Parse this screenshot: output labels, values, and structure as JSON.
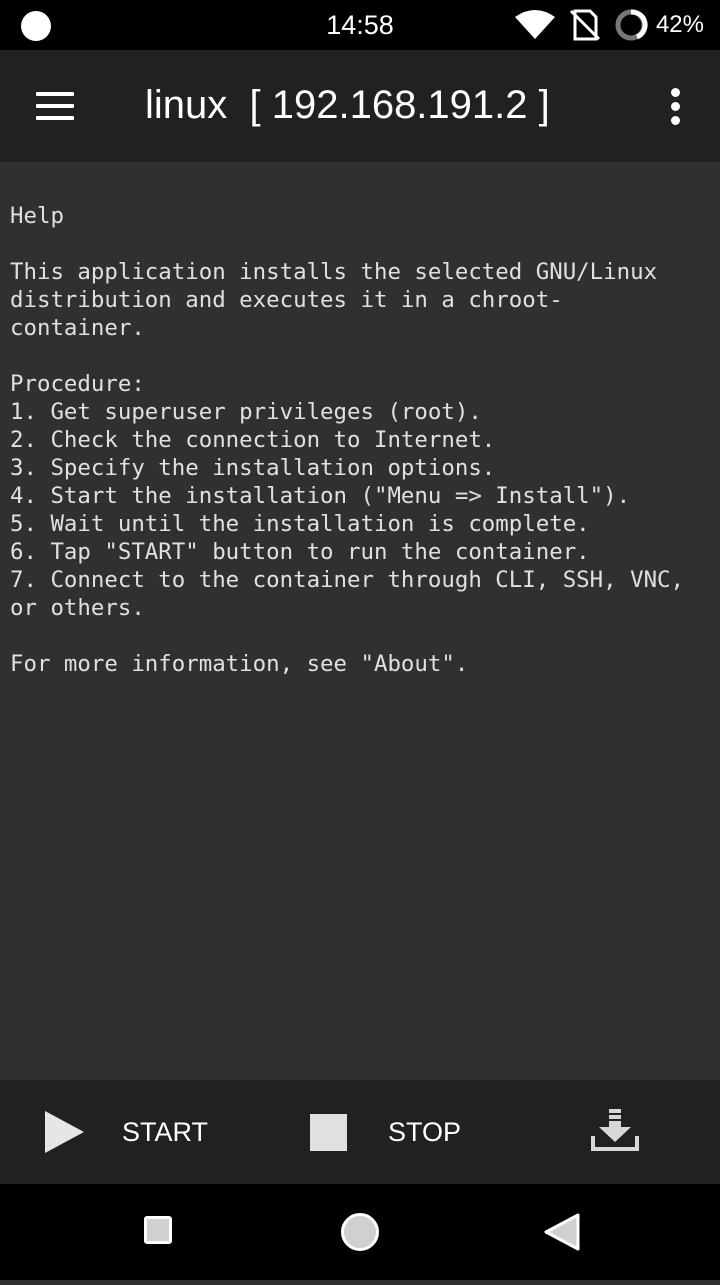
{
  "status_bar": {
    "time": "14:58",
    "battery_percent": "42%",
    "icons": [
      "notification-dot-icon",
      "wifi-icon",
      "no-sim-icon",
      "battery-saver-icon"
    ]
  },
  "app_bar": {
    "title": "linux  [ 192.168.191.2 ]",
    "menu_icon": "hamburger-menu-icon",
    "overflow_icon": "more-vert-icon"
  },
  "content": {
    "text": "Help\n\nThis application installs the selected GNU/Linux\ndistribution and executes it in a chroot-\ncontainer.\n\nProcedure:\n1. Get superuser privileges (root).\n2. Check the connection to Internet.\n3. Specify the installation options.\n4. Start the installation (\"Menu => Install\").\n5. Wait until the installation is complete.\n6. Tap \"START\" button to run the container.\n7. Connect to the container through CLI, SSH, VNC,\nor others.\n\nFor more information, see \"About\"."
  },
  "bottom_bar": {
    "start_label": "START",
    "stop_label": "STOP",
    "install_icon": "download-icon"
  },
  "nav_bar": {
    "icons": [
      "recent-apps-icon",
      "home-icon",
      "back-icon"
    ]
  },
  "colors": {
    "status_bar_bg": "#000000",
    "app_bar_bg": "#212121",
    "content_bg": "#303030",
    "text": "#e0e0e0"
  }
}
